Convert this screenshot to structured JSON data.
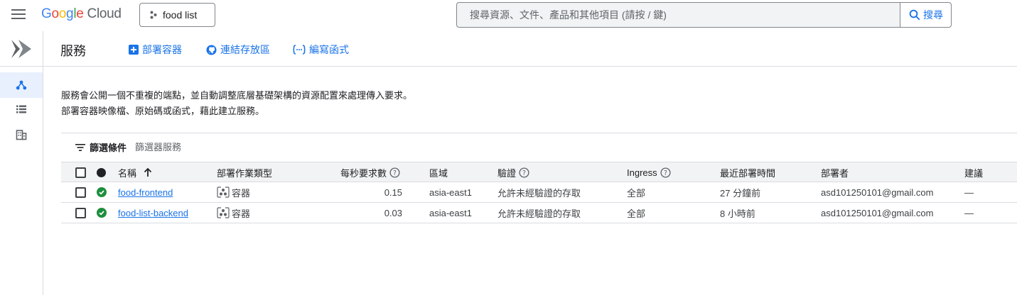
{
  "topbar": {
    "logo_letters": [
      "G",
      "o",
      "o",
      "g",
      "l",
      "e"
    ],
    "logo_suffix": "Cloud",
    "project": "food list",
    "search_placeholder": "搜尋資源、文件、產品和其他項目 (請按 / 鍵)",
    "search_button": "搜尋"
  },
  "header": {
    "title": "服務",
    "actions": [
      {
        "label": "部署容器",
        "icon": "add-box-icon"
      },
      {
        "label": "連結存放區",
        "icon": "github-icon"
      },
      {
        "label": "編寫函式",
        "icon": "function-icon"
      }
    ]
  },
  "description": {
    "line1": "服務會公開一個不重複的端點，並自動調整底層基礎架構的資源配置來處理傳入要求。",
    "line2": "部署容器映像檔、原始碼或函式，藉此建立服務。"
  },
  "filter": {
    "label": "篩選條件",
    "placeholder": "篩選器服務"
  },
  "table": {
    "columns": {
      "name": "名稱",
      "deploy_type": "部署作業類型",
      "rps": "每秒要求數",
      "region": "區域",
      "auth": "驗證",
      "ingress": "Ingress",
      "last_deployed": "最近部署時間",
      "deployer": "部署者",
      "recommendation": "建議"
    },
    "rows": [
      {
        "name": "food-frontend",
        "deploy_type": "容器",
        "rps": "0.15",
        "region": "asia-east1",
        "auth": "允許未經驗證的存取",
        "ingress": "全部",
        "last_deployed": "27 分鐘前",
        "deployer": "asd101250101@gmail.com",
        "recommendation": "—"
      },
      {
        "name": "food-list-backend",
        "deploy_type": "容器",
        "rps": "0.03",
        "region": "asia-east1",
        "auth": "允許未經驗證的存取",
        "ingress": "全部",
        "last_deployed": "8 小時前",
        "deployer": "asd101250101@gmail.com",
        "recommendation": "—"
      }
    ]
  },
  "colors": {
    "accent": "#1a73e8",
    "success": "#1e8e3e",
    "nav_active_bg": "#e8f0fe"
  }
}
